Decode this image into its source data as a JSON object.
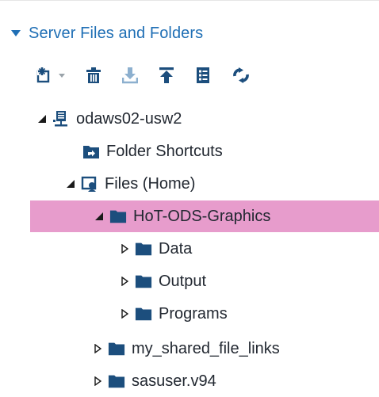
{
  "panel": {
    "title": "Server Files and Folders",
    "accent_color": "#1f6fb5",
    "expanded": true
  },
  "toolbar": {
    "buttons": [
      {
        "name": "new-item",
        "icon": "new-item-icon",
        "has_dropdown": true
      },
      {
        "name": "delete",
        "icon": "trash-icon"
      },
      {
        "name": "download",
        "icon": "download-icon",
        "disabled": true
      },
      {
        "name": "upload",
        "icon": "upload-icon"
      },
      {
        "name": "properties",
        "icon": "properties-icon"
      },
      {
        "name": "refresh",
        "icon": "refresh-icon"
      }
    ]
  },
  "tree": {
    "selected_color": "#e79ccc",
    "folder_color": "#1c4e7d",
    "nodes": [
      {
        "label": "odaws02-usw2",
        "icon": "server-icon",
        "level": 0,
        "state": "expanded"
      },
      {
        "label": "Folder Shortcuts",
        "icon": "folder-shortcut-icon",
        "level": 1,
        "state": "leaf"
      },
      {
        "label": "Files (Home)",
        "icon": "home-files-icon",
        "level": 1,
        "state": "expanded"
      },
      {
        "label": "HoT-ODS-Graphics",
        "icon": "folder-icon",
        "level": 2,
        "state": "expanded",
        "selected": true
      },
      {
        "label": "Data",
        "icon": "folder-icon",
        "level": 3,
        "state": "collapsed"
      },
      {
        "label": "Output",
        "icon": "folder-icon",
        "level": 3,
        "state": "collapsed"
      },
      {
        "label": "Programs",
        "icon": "folder-icon",
        "level": 3,
        "state": "collapsed"
      },
      {
        "label": "my_shared_file_links",
        "icon": "folder-icon",
        "level": 2,
        "state": "collapsed"
      },
      {
        "label": "sasuser.v94",
        "icon": "folder-icon",
        "level": 2,
        "state": "collapsed"
      }
    ]
  }
}
